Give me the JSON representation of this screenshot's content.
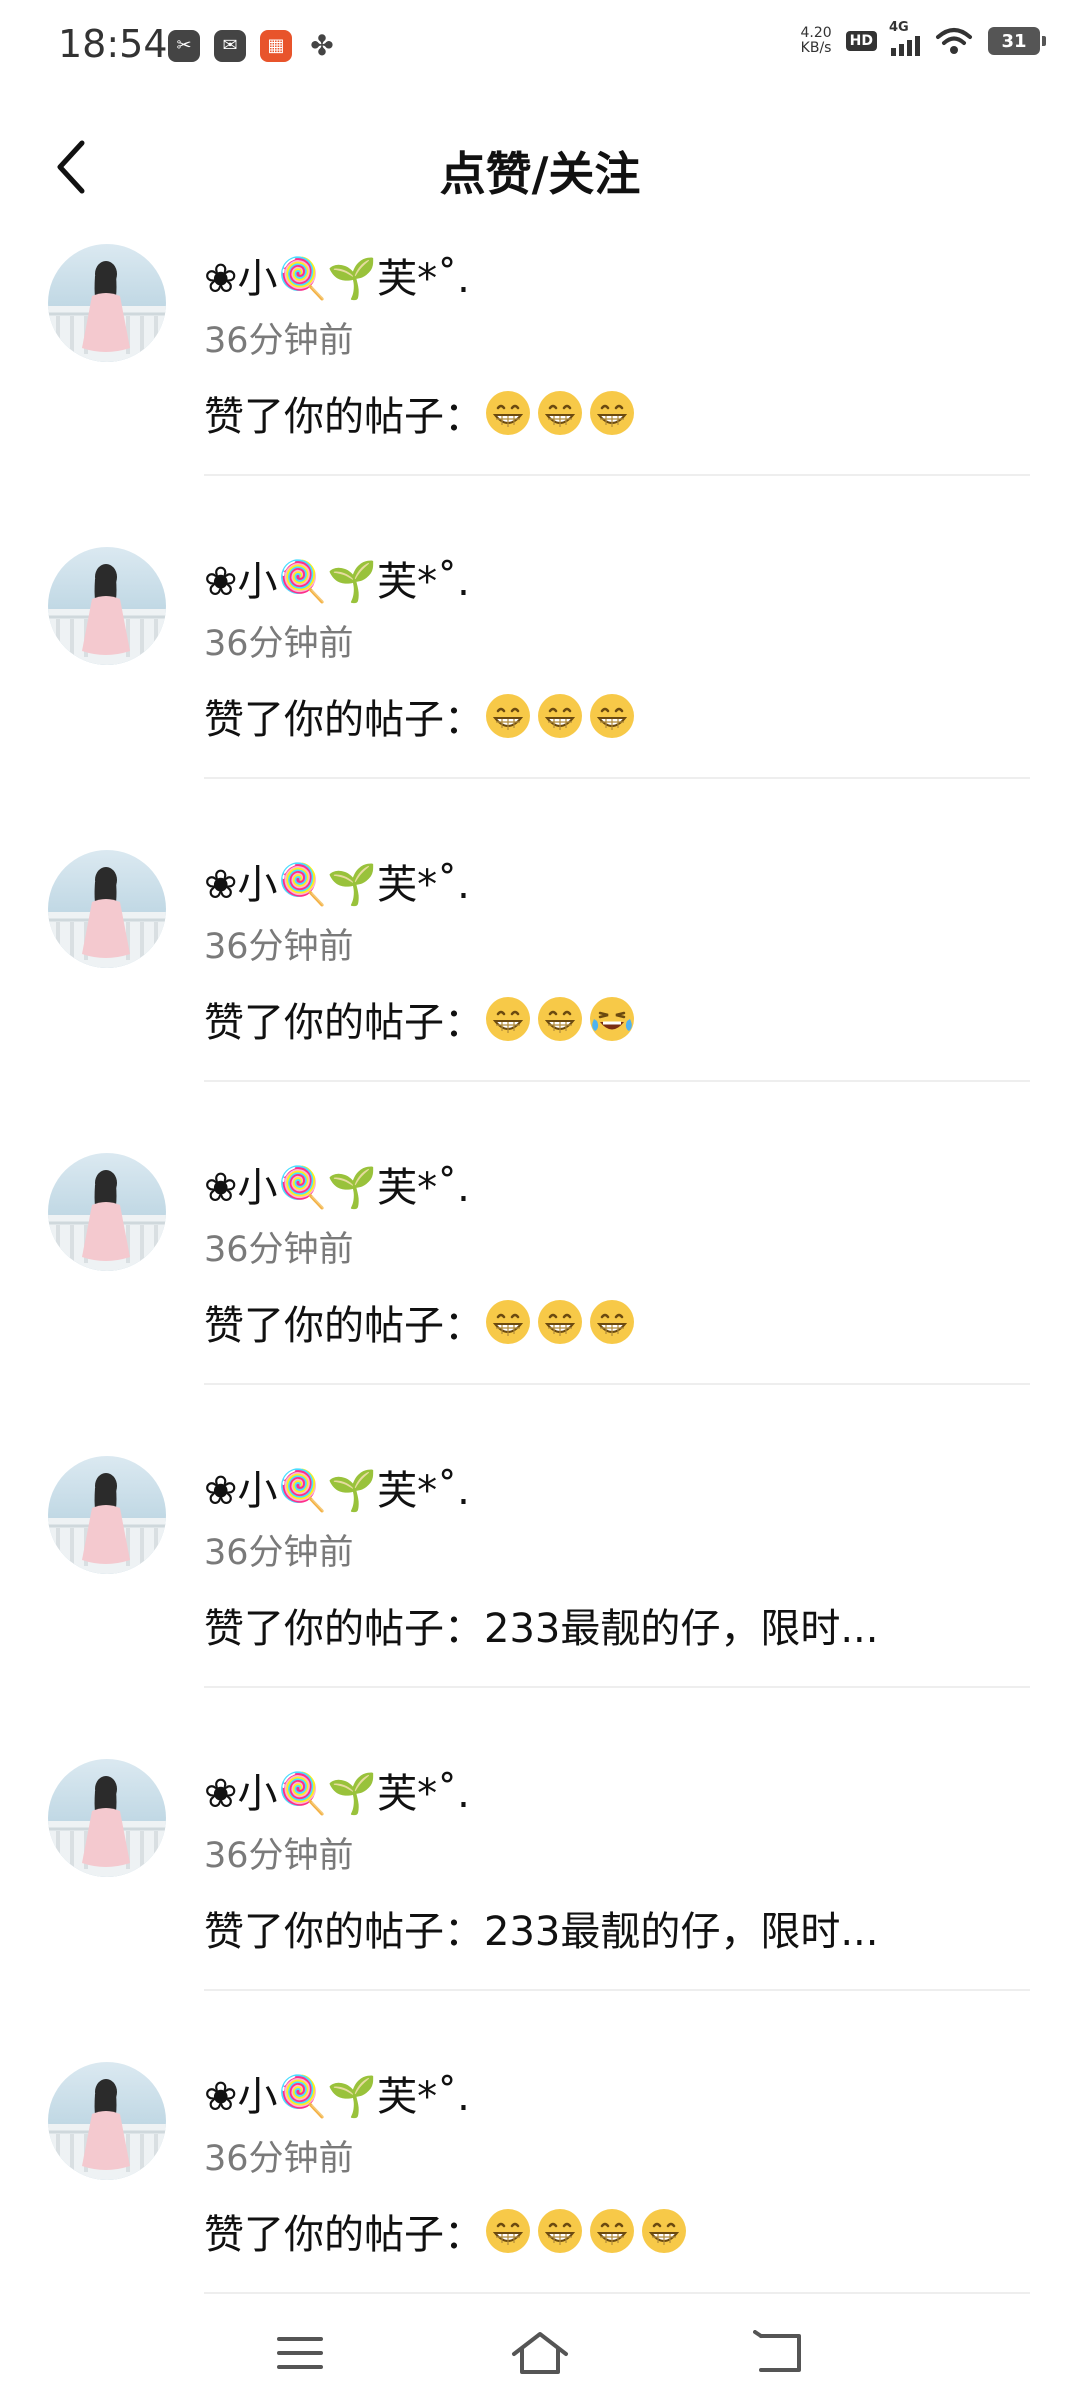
{
  "status_bar": {
    "time": "18:54",
    "net_speed_value": "4.20",
    "net_speed_unit": "KB/s",
    "hd_label": "HD",
    "signal_label": "4G",
    "battery_level": "31",
    "app_icons": [
      "scissors-icon",
      "mail-icon",
      "grid-app-icon",
      "pinwheel-icon"
    ]
  },
  "header": {
    "title": "点赞/关注",
    "back_icon": "chevron-left-icon"
  },
  "notifications": [
    {
      "name": "❀小🍭🌱芙*˚.",
      "time": "36分钟前",
      "action": "赞了你的帖子：",
      "content": "",
      "emojis": [
        "grin",
        "grin",
        "grin"
      ]
    },
    {
      "name": "❀小🍭🌱芙*˚.",
      "time": "36分钟前",
      "action": "赞了你的帖子：",
      "content": "",
      "emojis": [
        "grin",
        "grin",
        "grin"
      ]
    },
    {
      "name": "❀小🍭🌱芙*˚.",
      "time": "36分钟前",
      "action": "赞了你的帖子：",
      "content": "",
      "emojis": [
        "grin",
        "grin",
        "tears-of-joy"
      ]
    },
    {
      "name": "❀小🍭🌱芙*˚.",
      "time": "36分钟前",
      "action": "赞了你的帖子：",
      "content": "",
      "emojis": [
        "grin",
        "grin",
        "grin"
      ]
    },
    {
      "name": "❀小🍭🌱芙*˚.",
      "time": "36分钟前",
      "action": "赞了你的帖子：",
      "content": "233最靓的仔，限时...",
      "emojis": []
    },
    {
      "name": "❀小🍭🌱芙*˚.",
      "time": "36分钟前",
      "action": "赞了你的帖子：",
      "content": "233最靓的仔，限时...",
      "emojis": []
    },
    {
      "name": "❀小🍭🌱芙*˚.",
      "time": "36分钟前",
      "action": "赞了你的帖子：",
      "content": "",
      "emojis": [
        "grin",
        "grin",
        "grin",
        "grin"
      ]
    }
  ],
  "nav_bar": {
    "buttons": [
      "menu-icon",
      "home-icon",
      "back-icon"
    ]
  },
  "colors": {
    "time_text": "#7a7a7a",
    "divider": "#eeeeee",
    "emoji_face": "#f7c948"
  }
}
